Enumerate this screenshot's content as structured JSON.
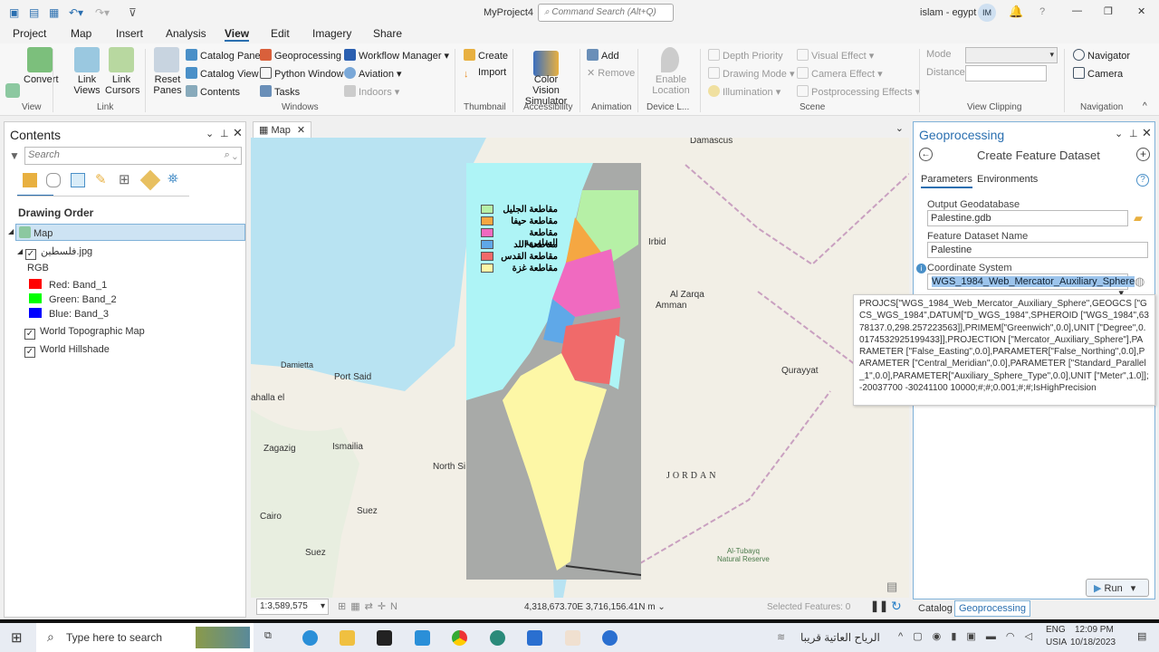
{
  "title_bar": {
    "project": "MyProject4",
    "command_search_placeholder": "Command Search (Alt+Q)",
    "user": "islam - egypt",
    "avatar": "IM",
    "help": "?",
    "minimize": "—",
    "restore": "❐",
    "close": "✕"
  },
  "tabs": [
    "Project",
    "Map",
    "Insert",
    "Analysis",
    "View",
    "Edit",
    "Imagery",
    "Share"
  ],
  "active_tab": "View",
  "ribbon": {
    "view": {
      "convert": "Convert",
      "group": "View"
    },
    "link": {
      "link_views": "Link Views",
      "link_cursors": "Link Cursors",
      "group": "Link"
    },
    "windows": {
      "reset_panes": "Reset Panes",
      "catalog_pane": "Catalog Pane",
      "catalog_view": "Catalog View",
      "contents": "Contents",
      "geoprocessing": "Geoprocessing",
      "python_window": "Python Window",
      "tasks": "Tasks",
      "workflow_manager": "Workflow Manager",
      "aviation": "Aviation",
      "indoors": "Indoors",
      "group": "Windows"
    },
    "thumbnail": {
      "create": "Create",
      "import": "Import",
      "group": "Thumbnail"
    },
    "accessibility": {
      "color_vision": "Color Vision Simulator",
      "group": "Accessibility"
    },
    "animation": {
      "add": "Add",
      "remove": "Remove",
      "group": "Animation"
    },
    "device": {
      "enable_location": "Enable Location",
      "group": "Device L..."
    },
    "scene": {
      "depth_priority": "Depth Priority",
      "drawing_mode": "Drawing Mode",
      "illumination": "Illumination",
      "visual_effect": "Visual Effect",
      "camera_effect": "Camera Effect",
      "postprocessing": "Postprocessing Effects",
      "group": "Scene"
    },
    "clipping": {
      "mode": "Mode",
      "distance": "Distance",
      "group": "View Clipping"
    },
    "navigation": {
      "navigator": "Navigator",
      "camera": "Camera",
      "group": "Navigation"
    }
  },
  "contents": {
    "title": "Contents",
    "search_placeholder": "Search",
    "drawing_order": "Drawing Order",
    "map": "Map",
    "layer": "فلسطين.jpg",
    "rgb": "RGB",
    "bands": [
      {
        "label": "Red:   Band_1",
        "color": "#ff0000"
      },
      {
        "label": "Green: Band_2",
        "color": "#00ff00"
      },
      {
        "label": "Blue:  Band_3",
        "color": "#0000ff"
      }
    ],
    "basemaps": [
      "World Topographic Map",
      "World Hillshade"
    ]
  },
  "map": {
    "tab": "Map",
    "scale": "1:3,589,575",
    "coords": "4,318,673.70E 3,716,156.41N m",
    "selected": "Selected Features: 0",
    "labels": [
      "Damascus",
      "Irbid",
      "Al Zarqa",
      "Amman",
      "Qurayyat",
      "Damietta",
      "Port Said",
      "ahalla el",
      "Zagazig",
      "Ismailia",
      "North Si",
      "JORDAN",
      "Suez",
      "Cairo",
      "Suez",
      "Al-Tubayq\nNatural Reserve"
    ],
    "legend": [
      {
        "label": "مقاطعة الجليل",
        "color": "#b6f0a6"
      },
      {
        "label": "مقاطعة حيفا",
        "color": "#f5a742"
      },
      {
        "label": "مقاطعة السامرية",
        "color": "#f06ac0"
      },
      {
        "label": "مقاطعة اللد",
        "color": "#5fa8e8"
      },
      {
        "label": "مقاطعة القدس",
        "color": "#f06a6a"
      },
      {
        "label": "مقاطعة غزة",
        "color": "#fdf7a6"
      }
    ]
  },
  "geoprocessing": {
    "title": "Geoprocessing",
    "tool": "Create Feature Dataset",
    "tab_params": "Parameters",
    "tab_env": "Environments",
    "output_gdb_label": "Output Geodatabase",
    "output_gdb": "Palestine.gdb",
    "name_label": "Feature Dataset Name",
    "name": "Palestine",
    "cs_label": "Coordinate System",
    "cs": "WGS_1984_Web_Mercator_Auxiliary_Sphere",
    "tooltip": "PROJCS[\"WGS_1984_Web_Mercator_Auxiliary_Sphere\",GEOGCS [\"GCS_WGS_1984\",DATUM[\"D_WGS_1984\",SPHEROID [\"WGS_1984\",6378137.0,298.257223563]],PRIMEM[\"Greenwich\",0.0],UNIT [\"Degree\",0.0174532925199433]],PROJECTION [\"Mercator_Auxiliary_Sphere\"],PARAMETER [\"False_Easting\",0.0],PARAMETER[\"False_Northing\",0.0],PARAMETER [\"Central_Meridian\",0.0],PARAMETER [\"Standard_Parallel_1\",0.0],PARAMETER[\"Auxiliary_Sphere_Type\",0.0],UNIT [\"Meter\",1.0]];-20037700 -30241100 10000;#;#;0.001;#;#;IsHighPrecision",
    "run": "Run",
    "bottom_tabs": [
      "Catalog",
      "Geoprocessing"
    ]
  },
  "taskbar": {
    "search_placeholder": "Type here to search",
    "weather": "الرياح العاتية قريبا",
    "lang": "ENG",
    "region": "USIA",
    "time": "12:09 PM",
    "date": "10/18/2023"
  }
}
